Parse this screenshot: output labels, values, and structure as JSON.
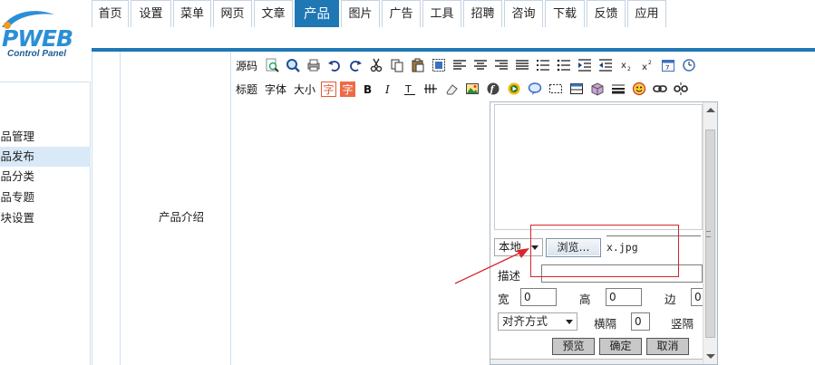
{
  "logo": {
    "text": "PWEB",
    "subtitle": "Control Panel",
    "brand_color": "#2b8fd6"
  },
  "left_nav": {
    "items": [
      {
        "label": "产品管理",
        "active": false
      },
      {
        "label": "产品发布",
        "active": true
      },
      {
        "label": "产品分类",
        "active": false
      },
      {
        "label": "产品专题",
        "active": false
      },
      {
        "label": "模块设置",
        "active": false
      }
    ]
  },
  "tabs": [
    {
      "label": "首页"
    },
    {
      "label": "设置"
    },
    {
      "label": "菜单"
    },
    {
      "label": "网页"
    },
    {
      "label": "文章"
    },
    {
      "label": "产品",
      "active": true
    },
    {
      "label": "图片"
    },
    {
      "label": "广告"
    },
    {
      "label": "工具"
    },
    {
      "label": "招聘"
    },
    {
      "label": "咨询"
    },
    {
      "label": "下载"
    },
    {
      "label": "反馈"
    },
    {
      "label": "应用"
    }
  ],
  "form": {
    "field_label": "产品介绍"
  },
  "toolbar": {
    "row1_source": "源码",
    "row2_labels": {
      "title": "标题",
      "font": "字体",
      "size": "大小",
      "fg": "字",
      "bg": "字"
    },
    "row1_icons": [
      "find-icon",
      "zoom-icon",
      "print-icon",
      "undo-icon",
      "redo-icon",
      "cut-icon",
      "copy-icon",
      "paste-icon",
      "select-all-icon",
      "align-left-icon",
      "align-center-icon",
      "align-right-icon",
      "justify-icon",
      "ordered-list-icon",
      "unordered-list-icon",
      "indent-icon",
      "outdent-icon",
      "subscript-icon",
      "superscript-icon",
      "date-icon",
      "time-icon"
    ],
    "row2_icons": [
      "bold-icon",
      "italic-icon",
      "underline-icon",
      "strikethrough-icon",
      "eraser-icon",
      "image-icon",
      "flash-icon",
      "media-icon",
      "link-cloud-icon",
      "hr-icon",
      "table-icon",
      "box-icon",
      "line-icon",
      "emoticon-icon",
      "link-icon",
      "unlink-icon"
    ]
  },
  "dialog": {
    "source_select": "本地",
    "browse_label": "浏览…",
    "filename": "x.jpg",
    "desc_label": "描述",
    "width_label": "宽",
    "width_value": "0",
    "height_label": "高",
    "height_value": "0",
    "border_label": "边",
    "border_value": "0",
    "align_select": "对齐方式",
    "hspace_label": "横隔",
    "hspace_value": "0",
    "vspace_label": "竖隔",
    "preview_btn": "预览",
    "ok_btn": "确定",
    "cancel_btn": "取消"
  },
  "colors": {
    "accent": "#1f78b4",
    "highlight": "#d8252b",
    "active_row": "#d9e9f8"
  }
}
